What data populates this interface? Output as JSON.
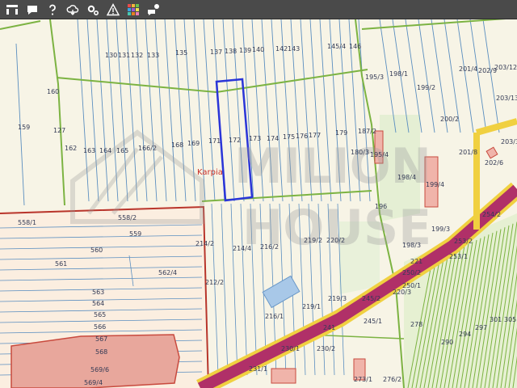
{
  "toolbar": {
    "tools": [
      {
        "name": "layers-tool-icon"
      },
      {
        "name": "comment-tool-icon"
      },
      {
        "name": "help-tool-icon"
      },
      {
        "name": "cloud-tool-icon"
      },
      {
        "name": "settings-tool-icon"
      },
      {
        "name": "warning-tool-icon"
      },
      {
        "name": "color-grid-tool-icon"
      },
      {
        "name": "chat-tool-icon"
      }
    ]
  },
  "map": {
    "place_label": "Karpia",
    "watermark": {
      "line1": "MILION",
      "line2": "HOUSE"
    },
    "colors": {
      "plot_line": "#5a8ec0",
      "highlight": "#2a35d8",
      "boundary": "#b8342a",
      "road": "#b03068",
      "place_label": "#c8302a",
      "green_line": "#7cb342"
    },
    "parcels": [
      {
        "t": "130"
      },
      {
        "t": "131"
      },
      {
        "t": "132"
      },
      {
        "t": "133"
      },
      {
        "t": "135"
      },
      {
        "t": "137"
      },
      {
        "t": "138"
      },
      {
        "t": "139"
      },
      {
        "t": "140"
      },
      {
        "t": "142"
      },
      {
        "t": "143"
      },
      {
        "t": "145/4"
      },
      {
        "t": "146"
      },
      {
        "t": "160"
      },
      {
        "t": "159"
      },
      {
        "t": "127"
      },
      {
        "t": "162"
      },
      {
        "t": "163"
      },
      {
        "t": "164"
      },
      {
        "t": "165"
      },
      {
        "t": "166/2"
      },
      {
        "t": "168"
      },
      {
        "t": "169"
      },
      {
        "t": "171"
      },
      {
        "t": "172"
      },
      {
        "t": "173"
      },
      {
        "t": "174"
      },
      {
        "t": "175"
      },
      {
        "t": "176"
      },
      {
        "t": "177"
      },
      {
        "t": "179"
      },
      {
        "t": "187/2"
      },
      {
        "t": "180/3"
      },
      {
        "t": "195/4"
      },
      {
        "t": "195/3"
      },
      {
        "t": "198/1"
      },
      {
        "t": "199/2"
      },
      {
        "t": "200/2"
      },
      {
        "t": "201/4"
      },
      {
        "t": "202/9"
      },
      {
        "t": "203/12"
      },
      {
        "t": "203/13"
      },
      {
        "t": "201/8"
      },
      {
        "t": "202/6"
      },
      {
        "t": "203/3"
      },
      {
        "t": "198/4"
      },
      {
        "t": "199/4"
      },
      {
        "t": "196"
      },
      {
        "t": "254/2"
      },
      {
        "t": "558/1"
      },
      {
        "t": "558/2"
      },
      {
        "t": "559"
      },
      {
        "t": "560"
      },
      {
        "t": "561"
      },
      {
        "t": "562/4"
      },
      {
        "t": "563"
      },
      {
        "t": "564"
      },
      {
        "t": "565"
      },
      {
        "t": "566"
      },
      {
        "t": "567"
      },
      {
        "t": "568"
      },
      {
        "t": "569/6"
      },
      {
        "t": "569/4"
      },
      {
        "t": "214/2"
      },
      {
        "t": "214/4"
      },
      {
        "t": "216/2"
      },
      {
        "t": "219/2"
      },
      {
        "t": "220/2"
      },
      {
        "t": "212/2"
      },
      {
        "t": "216/1"
      },
      {
        "t": "219/3"
      },
      {
        "t": "219/1"
      },
      {
        "t": "241"
      },
      {
        "t": "245/2"
      },
      {
        "t": "245/1"
      },
      {
        "t": "230/1"
      },
      {
        "t": "230/2"
      },
      {
        "t": "231/1"
      },
      {
        "t": "273/1"
      },
      {
        "t": "276/2"
      },
      {
        "t": "278"
      },
      {
        "t": "290"
      },
      {
        "t": "294"
      },
      {
        "t": "297"
      },
      {
        "t": "301"
      },
      {
        "t": "305"
      },
      {
        "t": "250/1"
      },
      {
        "t": "250/2"
      },
      {
        "t": "253/2"
      },
      {
        "t": "253/1"
      },
      {
        "t": "199/3"
      },
      {
        "t": "198/3"
      },
      {
        "t": "221"
      },
      {
        "t": "220/3"
      }
    ]
  }
}
